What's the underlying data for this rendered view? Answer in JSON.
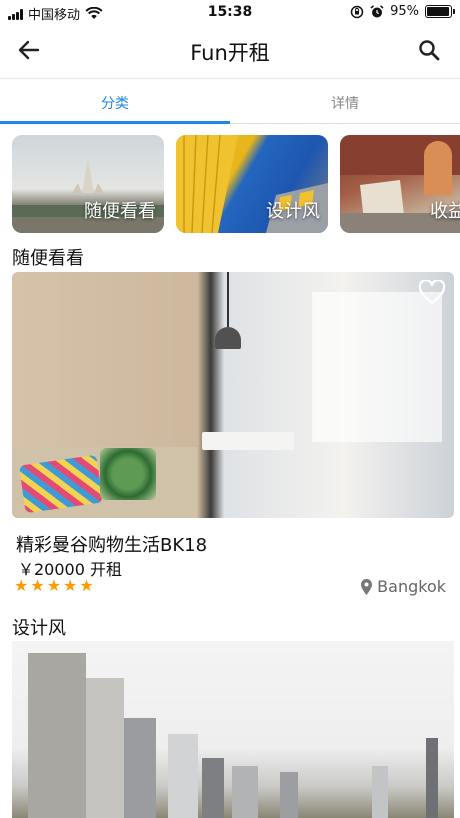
{
  "status_bar": {
    "carrier": "中国移动",
    "time": "15:38",
    "battery_level": 0.95,
    "battery": "95%"
  },
  "app_bar": {
    "title": "Fun开租",
    "back_icon": "arrow-back-icon",
    "search_icon": "search-icon"
  },
  "tabs": [
    {
      "label": "分类",
      "active": true
    },
    {
      "label": "详情",
      "active": false
    }
  ],
  "categories": [
    {
      "label": "随便看看"
    },
    {
      "label": "设计风"
    },
    {
      "label": "收益稳"
    }
  ],
  "sections": [
    {
      "title": "随便看看"
    },
    {
      "title": "设计风"
    }
  ],
  "listing": {
    "name": "精彩曼谷购物生活BK18",
    "price": "￥20000 开租",
    "rating": 5,
    "location": "Bangkok"
  },
  "colors": {
    "accent": "#1e88e5",
    "star": "#ff9a00"
  }
}
